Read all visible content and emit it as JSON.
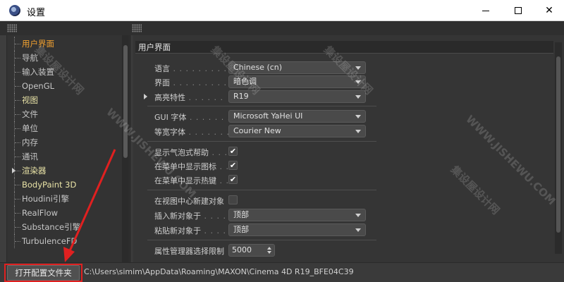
{
  "window": {
    "title": "设置",
    "min_icon": "minimize-icon",
    "max_icon": "maximize-icon",
    "close_label": "✕"
  },
  "sidebar": {
    "items": [
      {
        "label": "用户界面",
        "state": "active"
      },
      {
        "label": "导航",
        "state": "normal"
      },
      {
        "label": "输入装置",
        "state": "normal"
      },
      {
        "label": "OpenGL",
        "state": "normal"
      },
      {
        "label": "视图",
        "state": "bold"
      },
      {
        "label": "文件",
        "state": "normal"
      },
      {
        "label": "单位",
        "state": "normal"
      },
      {
        "label": "内存",
        "state": "normal"
      },
      {
        "label": "通讯",
        "state": "normal"
      },
      {
        "label": "渲染器",
        "state": "bold",
        "expandable": true
      },
      {
        "label": "BodyPaint 3D",
        "state": "bold"
      },
      {
        "label": "Houdini引擎",
        "state": "normal"
      },
      {
        "label": "RealFlow",
        "state": "normal"
      },
      {
        "label": "Substance引擎",
        "state": "normal"
      },
      {
        "label": "TurbulenceFD",
        "state": "normal"
      }
    ]
  },
  "main": {
    "section_title": "用户界面",
    "rows": {
      "language": {
        "label": "语言",
        "dots": " . . . . . . . . .",
        "value": "Chinese (cn)"
      },
      "ui_scheme": {
        "label": "界面",
        "dots": " . . . . . . . . .",
        "value": "暗色调"
      },
      "highlight": {
        "label": "高亮特性",
        "dots": " . . . . . .",
        "value": "R19"
      },
      "gui_font": {
        "label": "GUI 字体",
        "dots": " . . . . . . .",
        "value": "Microsoft YaHei UI"
      },
      "mono_font": {
        "label": "等宽字体",
        "dots": " . . . . . . .",
        "value": "Courier New"
      },
      "show_bubble_help": {
        "label": "显示气泡式帮助",
        "dots": " . . .",
        "checked": true
      },
      "show_menu_icons": {
        "label": "在菜单中显示图标",
        "dots": " . .",
        "checked": true
      },
      "show_menu_hotkeys": {
        "label": "在菜单中显示热键",
        "dots": " . .",
        "checked": true
      },
      "create_at_view_center": {
        "label": "在视图中心新建对象",
        "dots": "",
        "checked": false
      },
      "insert_new_object": {
        "label": "插入新对象于",
        "dots": " . . . .",
        "value": "顶部"
      },
      "paste_new_object": {
        "label": "粘贴新对象于",
        "dots": " . . . .",
        "value": "顶部"
      },
      "attr_manager_limit": {
        "label": "属性管理器选择限制",
        "dots": "",
        "value": "5000"
      }
    },
    "checkmark": "✔"
  },
  "bottom": {
    "open_folder_label": "打开配置文件夹",
    "path": "C:\\Users\\simim\\AppData\\Roaming\\MAXON\\Cinema 4D R19_BFE04C39"
  },
  "annotation": {
    "color": "#e02020"
  },
  "watermark": {
    "text_cn": "集设屋设计网",
    "text_en": "WWW.JISHEWU.COM"
  }
}
